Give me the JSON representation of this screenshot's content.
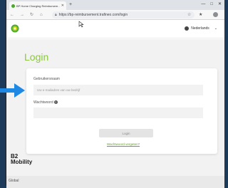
{
  "browser": {
    "tab_title": "BP Home Charging Reimbursem…",
    "url": "https://bp-reimbursement.trafineo.com/login"
  },
  "site": {
    "language": "Nederlands",
    "brand_text": "B2\nMobility",
    "footer_text": "Global"
  },
  "login": {
    "title": "Login",
    "username_label": "Gebruikersnaam",
    "username_placeholder": "Uw e-mailadres van uw bedrijf",
    "password_label": "Wachtwoord",
    "submit_label": "Login",
    "forgot_link": "Wachtwoord vergeten?"
  },
  "colors": {
    "accent_green": "#8cc63f",
    "arrow_blue": "#1e88e5"
  },
  "icons": {
    "favicon": "bp-logo-icon",
    "globe": "globe-icon",
    "help": "help-icon",
    "arrow": "pointer-arrow-icon"
  }
}
